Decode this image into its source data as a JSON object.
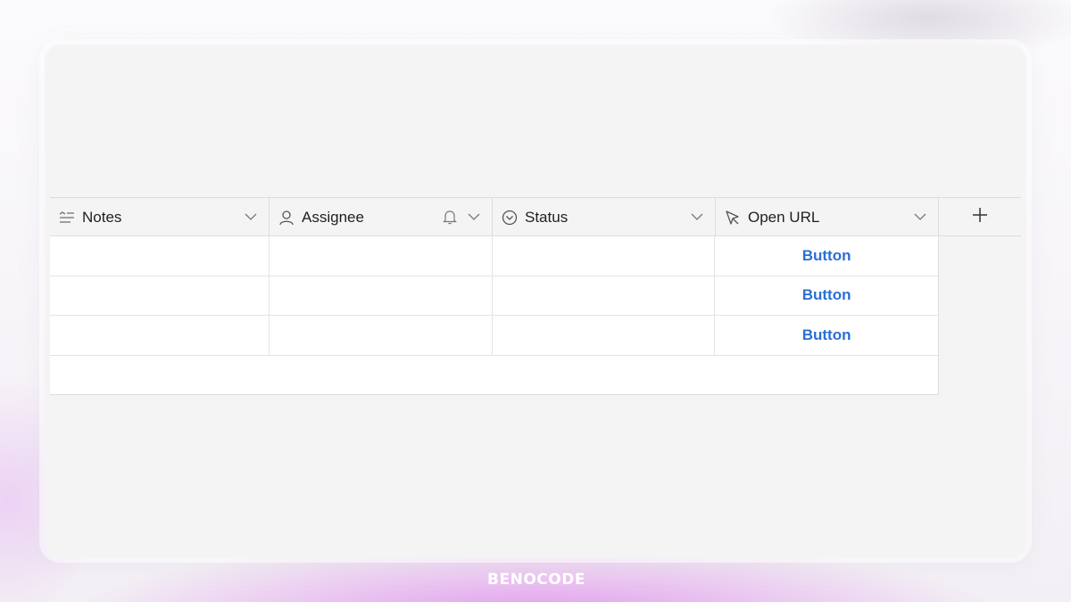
{
  "columns": [
    {
      "label": "Notes",
      "icon": "text-lines-icon"
    },
    {
      "label": "Assignee",
      "icon": "user-icon"
    },
    {
      "label": "Status",
      "icon": "circle-chevron-icon"
    },
    {
      "label": "Open URL",
      "icon": "cursor-arrow-icon"
    }
  ],
  "rows": [
    {
      "open_url": "Button"
    },
    {
      "open_url": "Button"
    },
    {
      "open_url": "Button"
    }
  ],
  "brand": {
    "logo_text": "BENOCODE"
  },
  "colors": {
    "accent": "#2a6fd6",
    "border": "#dddddd",
    "card_bg": "#f4f4f4",
    "glow": "#de8ceb"
  }
}
